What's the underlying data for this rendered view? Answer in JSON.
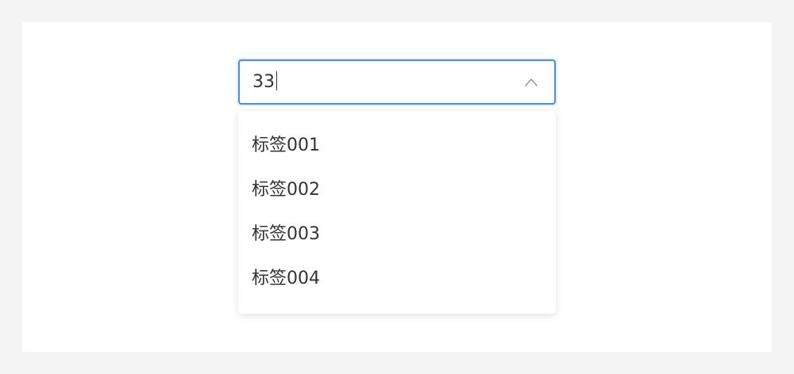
{
  "select": {
    "value": "33",
    "icon": "chevron-up-icon",
    "accent_color": "#4a90e2"
  },
  "dropdown": {
    "options": [
      {
        "label": "标签001"
      },
      {
        "label": "标签002"
      },
      {
        "label": "标签003"
      },
      {
        "label": "标签004"
      }
    ]
  }
}
